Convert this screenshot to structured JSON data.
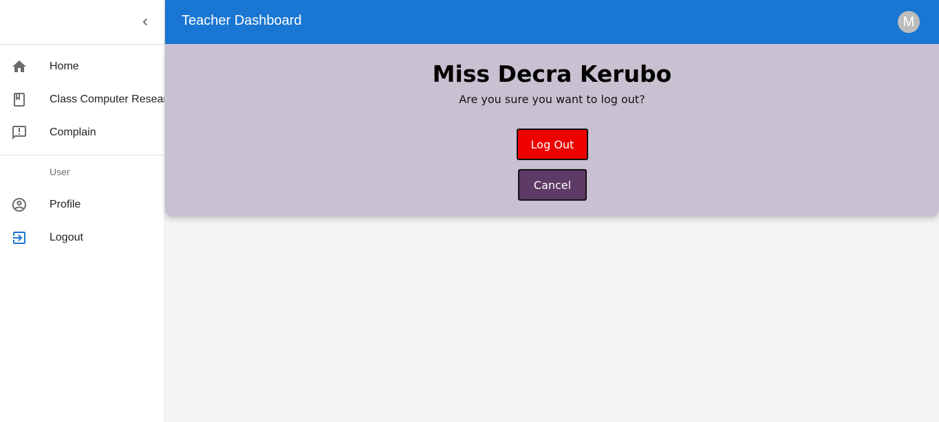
{
  "colors": {
    "appbar": "#1976d2",
    "panel": "#c9c1d2",
    "logout_button": "#ee0000",
    "cancel_button": "#5e3a66",
    "logout_icon": "#1976d2"
  },
  "sidebar": {
    "collapse_icon": "chevron-left-icon",
    "items": [
      {
        "label": "Home",
        "icon": "home-icon"
      },
      {
        "label": "Class Computer Research",
        "icon": "class-book-icon"
      },
      {
        "label": "Complain",
        "icon": "complain-icon"
      }
    ],
    "section_label": "User",
    "user_items": [
      {
        "label": "Profile",
        "icon": "account-circle-icon"
      },
      {
        "label": "Logout",
        "icon": "logout-icon"
      }
    ]
  },
  "header": {
    "title": "Teacher Dashboard",
    "avatar_initial": "M"
  },
  "logout_dialog": {
    "name": "Miss Decra Kerubo",
    "message": "Are you sure you want to log out?",
    "logout_label": "Log Out",
    "cancel_label": "Cancel"
  }
}
